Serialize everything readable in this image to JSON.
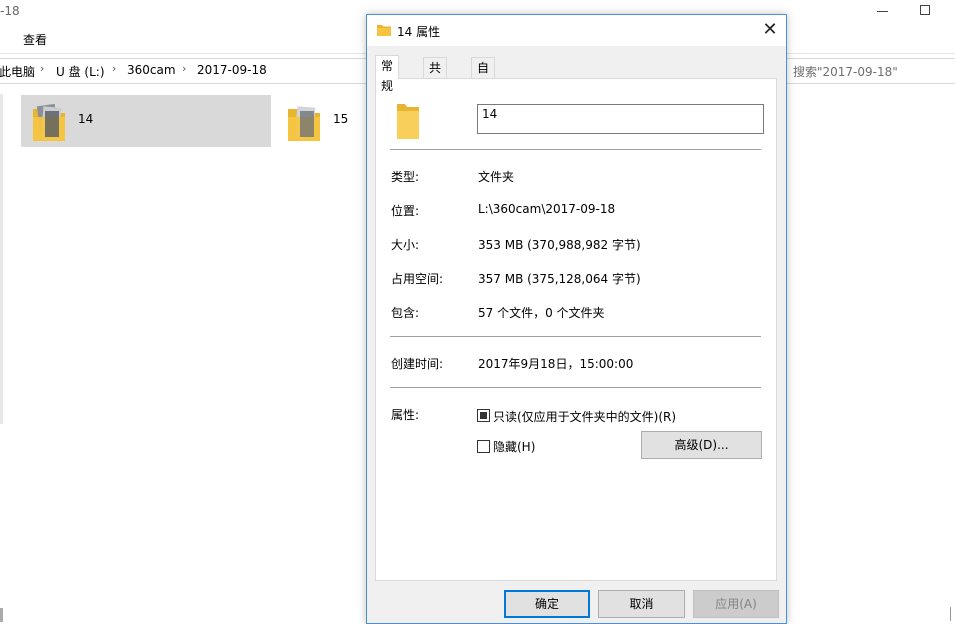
{
  "explorer": {
    "title_fragment": "-18",
    "menu": {
      "view": "查看"
    },
    "breadcrumb": [
      "此电脑",
      "U 盘 (L:)",
      "360cam",
      "2017-09-18"
    ],
    "search_placeholder": "搜索\"2017-09-18\"",
    "folders": [
      {
        "name": "14",
        "selected": true
      },
      {
        "name": "15",
        "selected": false
      }
    ]
  },
  "dialog": {
    "title": "14 属性",
    "close_glyph": "✕",
    "tabs": [
      "常规",
      "共享",
      "自定义"
    ],
    "active_tab": "常规",
    "folder_name_value": "14",
    "properties": [
      {
        "label": "类型:",
        "value": "文件夹"
      },
      {
        "label": "位置:",
        "value": "L:\\360cam\\2017-09-18"
      },
      {
        "label": "大小:",
        "value": "353 MB (370,988,982 字节)"
      },
      {
        "label": "占用空间:",
        "value": "357 MB (375,128,064 字节)"
      },
      {
        "label": "包含:",
        "value": "57 个文件，0 个文件夹"
      }
    ],
    "created": {
      "label": "创建时间:",
      "value": "2017年9月18日，15:00:00"
    },
    "attributes": {
      "label": "属性:",
      "readonly": {
        "label": "只读(仅应用于文件夹中的文件)(R)",
        "state": "indeterminate"
      },
      "hidden": {
        "label": "隐藏(H)",
        "checked": false
      },
      "advanced_button": "高级(D)..."
    },
    "buttons": {
      "ok": "确定",
      "cancel": "取消",
      "apply": "应用(A)"
    }
  },
  "colors": {
    "dialog_border": "#4a8fd8",
    "selection": "#d9d9d9",
    "default_button_border": "#0078d7",
    "folder_yellow": "#f5c542"
  },
  "icons": [
    "folder-icon",
    "close-icon",
    "chevron-right-icon",
    "minimize-icon",
    "maximize-icon"
  ]
}
